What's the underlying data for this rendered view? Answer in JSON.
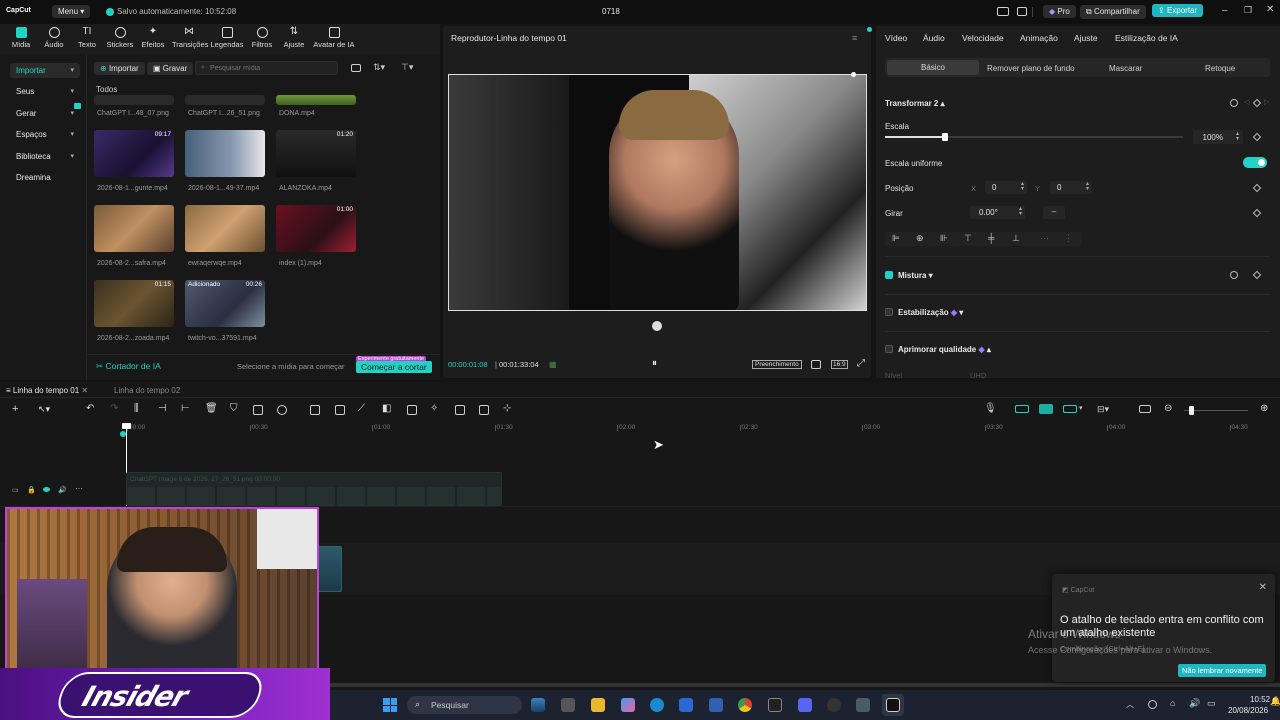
{
  "titlebar": {
    "logo": "CapCut",
    "menu": "Menu",
    "autosave": "Salvo automaticamente: 10:52:08",
    "project": "0718",
    "pro": "Pro",
    "share": "Compartilhar",
    "export": "Exportar"
  },
  "toolbar": [
    {
      "label": "Mídia"
    },
    {
      "label": "Áudio"
    },
    {
      "label": "Texto"
    },
    {
      "label": "Stickers"
    },
    {
      "label": "Efeitos"
    },
    {
      "label": "Transições"
    },
    {
      "label": "Legendas"
    },
    {
      "label": "Filtros"
    },
    {
      "label": "Ajuste"
    },
    {
      "label": "Avatar de IA"
    }
  ],
  "sidebar": [
    {
      "label": "Importar"
    },
    {
      "label": "Seus"
    },
    {
      "label": "Gerar"
    },
    {
      "label": "Espaços"
    },
    {
      "label": "Biblioteca"
    },
    {
      "label": "Dreamina"
    }
  ],
  "media": {
    "import": "Importar",
    "record": "Gravar",
    "search_placeholder": "Pesquisar mídia",
    "filter": "Todos",
    "row0": [
      "ChatGPT I...48_07.png",
      "ChatGPT I...26_51.png",
      "DONA.mp4"
    ],
    "items": [
      {
        "name": "2026-08-1...gunte.mp4",
        "dur": "09:17"
      },
      {
        "name": "2026-08-1...49-37.mp4",
        "dur": ""
      },
      {
        "name": "ALANZOKA.mp4",
        "dur": "01:20"
      },
      {
        "name": "2026-08-2...safra.mp4",
        "dur": ""
      },
      {
        "name": "ewraqerwqe.mp4",
        "dur": ""
      },
      {
        "name": "index (1).mp4",
        "dur": "01:00"
      },
      {
        "name": "2026-08-2...zoada.mp4",
        "dur": "01:15"
      },
      {
        "name": "twitch-vo...37591.mp4",
        "dur": "00:26",
        "badge": "Adicionado"
      }
    ],
    "ai_cutter": "Cortador de IA",
    "select_hint": "Selecione a mídia para começar",
    "free_badge": "Experimente gratuitamente",
    "start_cut": "Começar a cortar"
  },
  "player": {
    "title": "Reprodutor-Linha do tempo 01",
    "current": "00:00:01:08",
    "total": "00:01:33:04",
    "fill": "Preenchimento",
    "ratio": "16:9"
  },
  "props": {
    "tabs": [
      "Vídeo",
      "Áudio",
      "Velocidade",
      "Animação",
      "Ajuste",
      "Estilização de IA"
    ],
    "subtabs": [
      "Básico",
      "Remover plano de fundo",
      "Mascarar",
      "Retoque"
    ],
    "transform": "Transformar 2",
    "scale": "Escala",
    "scale_value": "100%",
    "scale_fraction": 1.0,
    "uniform": "Escala uniforme",
    "position": "Posição",
    "pos_x_label": "X",
    "pos_x": "0",
    "pos_y_label": "Y",
    "pos_y": "0",
    "rotate": "Girar",
    "rotate_value": "0.00°",
    "blend": "Mistura",
    "stabilize": "Estabilização",
    "enhance": "Aprimorar qualidade",
    "level": "Nível",
    "level_value": "UHD"
  },
  "timeline": {
    "tabs": [
      "Linha do tempo 01",
      "Linha do tempo 02"
    ],
    "ruler": [
      "00:00",
      "00:30",
      "01:00",
      "01:30",
      "02:00",
      "02:30",
      "03:00",
      "03:30",
      "04:00",
      "04:30"
    ],
    "clip_label": "ChatGPT Image 6 de 2026, 17_26_51.png  00:00:00"
  },
  "toast": {
    "app": "CapCut",
    "message": "O atalho de teclado entra em conflito com um atalho existente",
    "sub": "Combinação: [Ctrl+Alt+E]",
    "dismiss": "Não lembrar novamente"
  },
  "watermark": {
    "line1": "Ativar o Windows",
    "line2": "Acesse Configurações para ativar o Windows."
  },
  "taskbar": {
    "search": "Pesquisar",
    "time": "10:52",
    "date": "20/08/2026"
  },
  "webcam": {
    "logo_text": "Insider"
  },
  "colors": {
    "accent": "#22d3c5",
    "export": "#1fb6c2",
    "bg": "#141414",
    "panel": "#1c1c1c"
  }
}
